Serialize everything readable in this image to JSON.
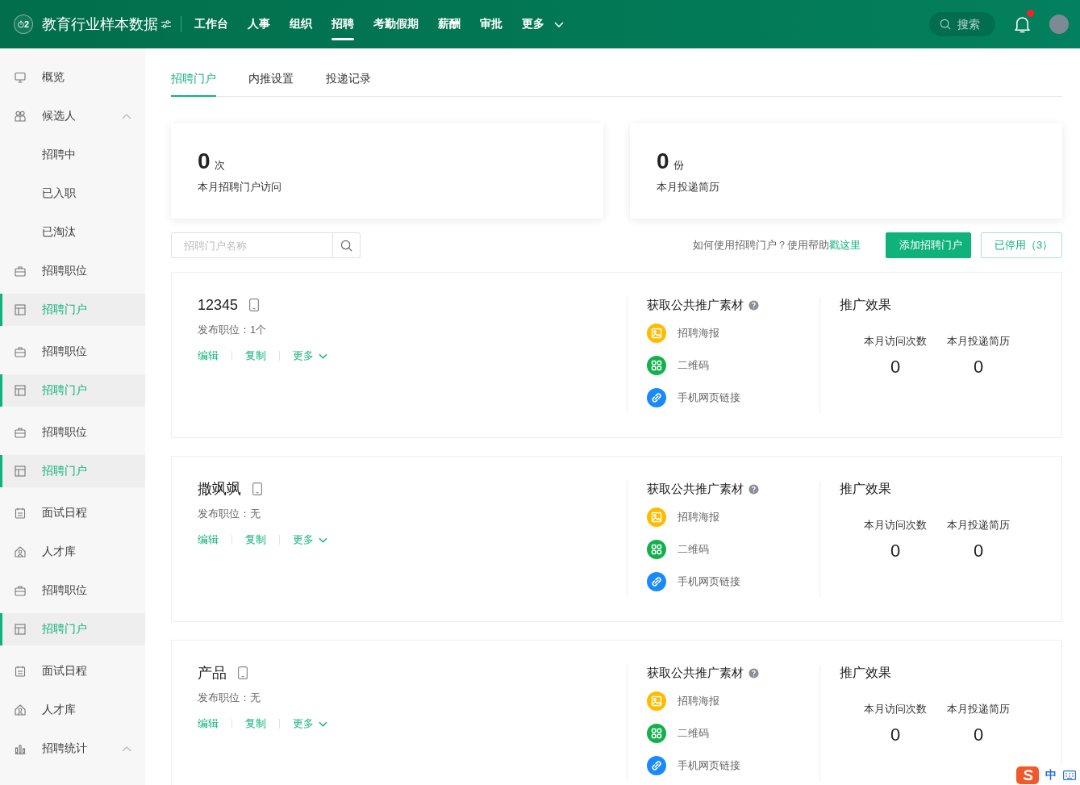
{
  "top_bar": {
    "logo_mark": "2",
    "org_name": "教育行业样本数据",
    "nav": [
      {
        "label": "工作台",
        "selected": false,
        "kind": "link"
      },
      {
        "label": "人事",
        "selected": false,
        "kind": "link"
      },
      {
        "label": "组织",
        "selected": false,
        "kind": "link"
      },
      {
        "label": "招聘",
        "selected": true,
        "kind": "link"
      },
      {
        "label": "考勤假期",
        "selected": false,
        "kind": "link"
      },
      {
        "label": "薪酬",
        "selected": false,
        "kind": "link"
      },
      {
        "label": "审批",
        "selected": false,
        "kind": "link"
      },
      {
        "label": "更多",
        "selected": false,
        "kind": "dropdown"
      }
    ],
    "search": {
      "placeholder": "搜索"
    },
    "notifications": {
      "unread": true
    }
  },
  "sidebar": {
    "items": [
      {
        "kind": "overview",
        "label": "概览",
        "selected": false
      },
      {
        "kind": "candidates",
        "label": "候选人",
        "selected": false,
        "expanded": true,
        "children": [
          {
            "label": "招聘中",
            "selected": false
          },
          {
            "label": "已入职",
            "selected": false
          },
          {
            "label": "已淘汰",
            "selected": false
          }
        ]
      },
      {
        "kind": "positions",
        "label": "招聘职位",
        "selected": false
      },
      {
        "kind": "portal",
        "label": "招聘门户",
        "selected": true
      },
      {
        "kind": "positions",
        "label": "招聘职位",
        "selected": false
      },
      {
        "kind": "portal",
        "label": "招聘门户",
        "selected": true
      },
      {
        "kind": "positions",
        "label": "招聘职位",
        "selected": false
      },
      {
        "kind": "portal",
        "label": "招聘门户",
        "selected": true
      },
      {
        "kind": "interviews",
        "label": "面试日程",
        "selected": false
      },
      {
        "kind": "talent",
        "label": "人才库",
        "selected": false
      },
      {
        "kind": "positions",
        "label": "招聘职位",
        "selected": false
      },
      {
        "kind": "portal",
        "label": "招聘门户",
        "selected": true
      },
      {
        "kind": "interviews",
        "label": "面试日程",
        "selected": false
      },
      {
        "kind": "talent",
        "label": "人才库",
        "selected": false
      },
      {
        "kind": "statistics",
        "label": "招聘统计",
        "selected": false,
        "expanded": true
      }
    ]
  },
  "tabs": [
    {
      "label": "招聘门户",
      "selected": true
    },
    {
      "label": "内推设置",
      "selected": false
    },
    {
      "label": "投递记录",
      "selected": false
    }
  ],
  "summary_cards": [
    {
      "value": "0",
      "unit": "次",
      "label": "本月招聘门户访问"
    },
    {
      "value": "0",
      "unit": "份",
      "label": "本月投递简历"
    }
  ],
  "toolbar": {
    "search": {
      "placeholder": "招聘门户名称"
    },
    "help_text": "如何使用招聘门户？使用帮助",
    "help_link": "戳这里",
    "buttons": [
      {
        "label": "添加招聘门户",
        "kind": "primary"
      },
      {
        "label": "已停用（3）",
        "kind": "outline"
      }
    ]
  },
  "portals": [
    {
      "name": "12345",
      "positions": "发布职位：1个",
      "actions": [
        {
          "label": "编辑",
          "kind": "link"
        },
        {
          "label": "复制",
          "kind": "link"
        },
        {
          "label": "更多",
          "kind": "dropdown"
        }
      ],
      "materials": {
        "title": "获取公共推广素材",
        "items": [
          {
            "kind": "poster",
            "label": "招聘海报",
            "color": "#ffbb00"
          },
          {
            "kind": "qrcode",
            "label": "二维码",
            "color": "#13b04c"
          },
          {
            "kind": "link",
            "label": "手机网页链接",
            "color": "#1a89fa"
          }
        ]
      },
      "effect": {
        "title": "推广效果",
        "stats": [
          {
            "label": "本月访问次数",
            "value": "0"
          },
          {
            "label": "本月投递简历",
            "value": "0"
          }
        ]
      }
    },
    {
      "name": "撒飒飒",
      "positions": "发布职位：无",
      "actions": [
        {
          "label": "编辑",
          "kind": "link"
        },
        {
          "label": "复制",
          "kind": "link"
        },
        {
          "label": "更多",
          "kind": "dropdown"
        }
      ],
      "materials": {
        "title": "获取公共推广素材",
        "items": [
          {
            "kind": "poster",
            "label": "招聘海报",
            "color": "#ffbb00"
          },
          {
            "kind": "qrcode",
            "label": "二维码",
            "color": "#13b04c"
          },
          {
            "kind": "link",
            "label": "手机网页链接",
            "color": "#1a89fa"
          }
        ]
      },
      "effect": {
        "title": "推广效果",
        "stats": [
          {
            "label": "本月访问次数",
            "value": "0"
          },
          {
            "label": "本月投递简历",
            "value": "0"
          }
        ]
      }
    },
    {
      "name": "产品",
      "positions": "发布职位：无",
      "actions": [
        {
          "label": "编辑",
          "kind": "link"
        },
        {
          "label": "复制",
          "kind": "link"
        },
        {
          "label": "更多",
          "kind": "dropdown"
        }
      ],
      "materials": {
        "title": "获取公共推广素材",
        "items": [
          {
            "kind": "poster",
            "label": "招聘海报",
            "color": "#ffbb00"
          },
          {
            "kind": "qrcode",
            "label": "二维码",
            "color": "#13b04c"
          },
          {
            "kind": "link",
            "label": "手机网页链接",
            "color": "#1a89fa"
          }
        ]
      },
      "effect": {
        "title": "推广效果",
        "stats": [
          {
            "label": "本月访问次数",
            "value": "0"
          },
          {
            "label": "本月投递简历",
            "value": "0"
          }
        ]
      }
    }
  ],
  "ime_indicator": {
    "mode": "中"
  }
}
